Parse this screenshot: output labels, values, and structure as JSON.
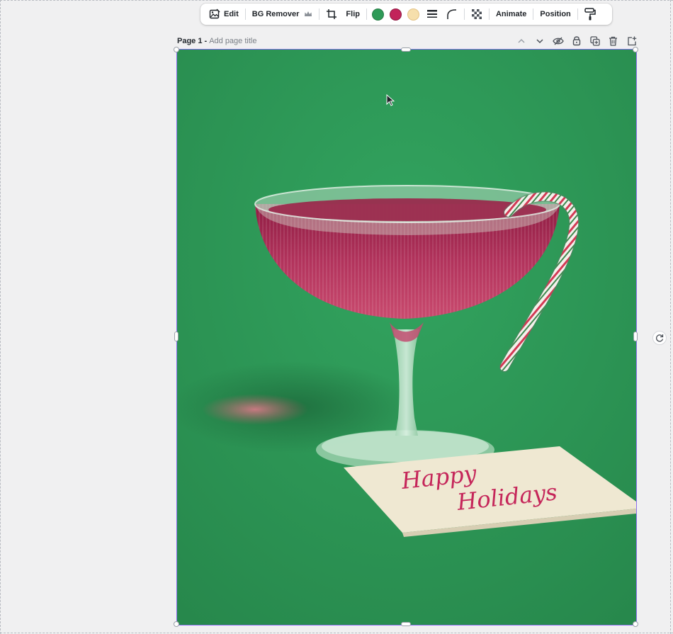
{
  "toolbar": {
    "edit_label": "Edit",
    "bg_remover_label": "BG Remover",
    "flip_label": "Flip",
    "animate_label": "Animate",
    "position_label": "Position",
    "colors": [
      "#2e9a57",
      "#c2245a",
      "#f6dfac"
    ],
    "icons": [
      "edit-image-icon",
      "crown-icon",
      "crop-icon",
      "border-style-icon",
      "corner-rounding-icon",
      "transparency-icon",
      "paint-roller-icon"
    ]
  },
  "page": {
    "label": "Page 1 -",
    "title_placeholder": "Add page title",
    "action_icons": [
      "chevron-up-icon",
      "chevron-down-icon",
      "hide-eye-icon",
      "lock-icon",
      "duplicate-icon",
      "trash-icon",
      "add-page-icon"
    ]
  },
  "canvas": {
    "background_color": "#2e9b58",
    "card_text_line1": "Happy",
    "card_text_line2": "Holidays"
  }
}
